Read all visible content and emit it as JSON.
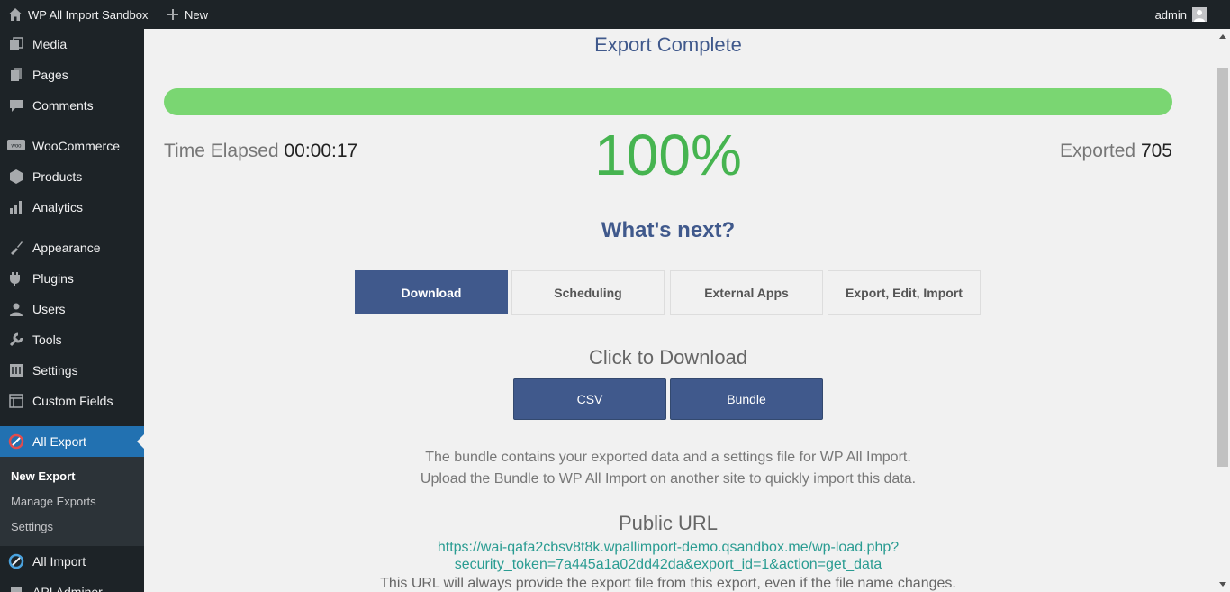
{
  "adminbar": {
    "site_name": "WP All Import Sandbox",
    "new_label": "New",
    "user_label": "admin"
  },
  "sidebar": {
    "items": [
      {
        "label": "Media",
        "icon": "media-icon"
      },
      {
        "label": "Pages",
        "icon": "pages-icon"
      },
      {
        "label": "Comments",
        "icon": "comments-icon"
      },
      {
        "label": "WooCommerce",
        "icon": "woocommerce-icon"
      },
      {
        "label": "Products",
        "icon": "products-icon"
      },
      {
        "label": "Analytics",
        "icon": "analytics-icon"
      },
      {
        "label": "Appearance",
        "icon": "appearance-icon"
      },
      {
        "label": "Plugins",
        "icon": "plugins-icon"
      },
      {
        "label": "Users",
        "icon": "users-icon"
      },
      {
        "label": "Tools",
        "icon": "tools-icon"
      },
      {
        "label": "Settings",
        "icon": "settings-icon"
      },
      {
        "label": "Custom Fields",
        "icon": "custom-fields-icon"
      },
      {
        "label": "All Export",
        "icon": "all-export-icon",
        "active": true
      },
      {
        "label": "All Import",
        "icon": "all-import-icon"
      },
      {
        "label": "API Adminer",
        "icon": "api-adminer-icon"
      }
    ],
    "submenu": [
      {
        "label": "New Export",
        "current": true
      },
      {
        "label": "Manage Exports"
      },
      {
        "label": "Settings"
      }
    ]
  },
  "main": {
    "title": "Export Complete",
    "progress_percent": 100,
    "time_elapsed_label": "Time Elapsed",
    "time_elapsed_value": "00:00:17",
    "percent_text": "100%",
    "exported_label": "Exported",
    "exported_value": "705",
    "whats_next": "What's next?",
    "tabs": [
      {
        "label": "Download",
        "active": true
      },
      {
        "label": "Scheduling"
      },
      {
        "label": "External Apps"
      },
      {
        "label": "Export, Edit, Import"
      }
    ],
    "click_to_download": "Click to Download",
    "csv_button": "CSV",
    "bundle_button": "Bundle",
    "bundle_desc_1": "The bundle contains your exported data and a settings file for WP All Import.",
    "bundle_desc_2": "Upload the Bundle to WP All Import on another site to quickly import this data.",
    "public_url_heading": "Public URL",
    "public_url_line1": "https://wai-qafa2cbsv8t8k.wpallimport-demo.qsandbox.me/wp-load.php?",
    "public_url_line2": "security_token=7a445a1a02dd42da&export_id=1&action=get_data",
    "public_url_note": "This URL will always provide the export file from this export, even if the file name changes."
  },
  "colors": {
    "accent": "#40598c",
    "progress": "#7ad672",
    "percent": "#46b450",
    "sidebar_bg": "#1d2327",
    "active_menu": "#2271b1",
    "link": "#2a9c92"
  }
}
